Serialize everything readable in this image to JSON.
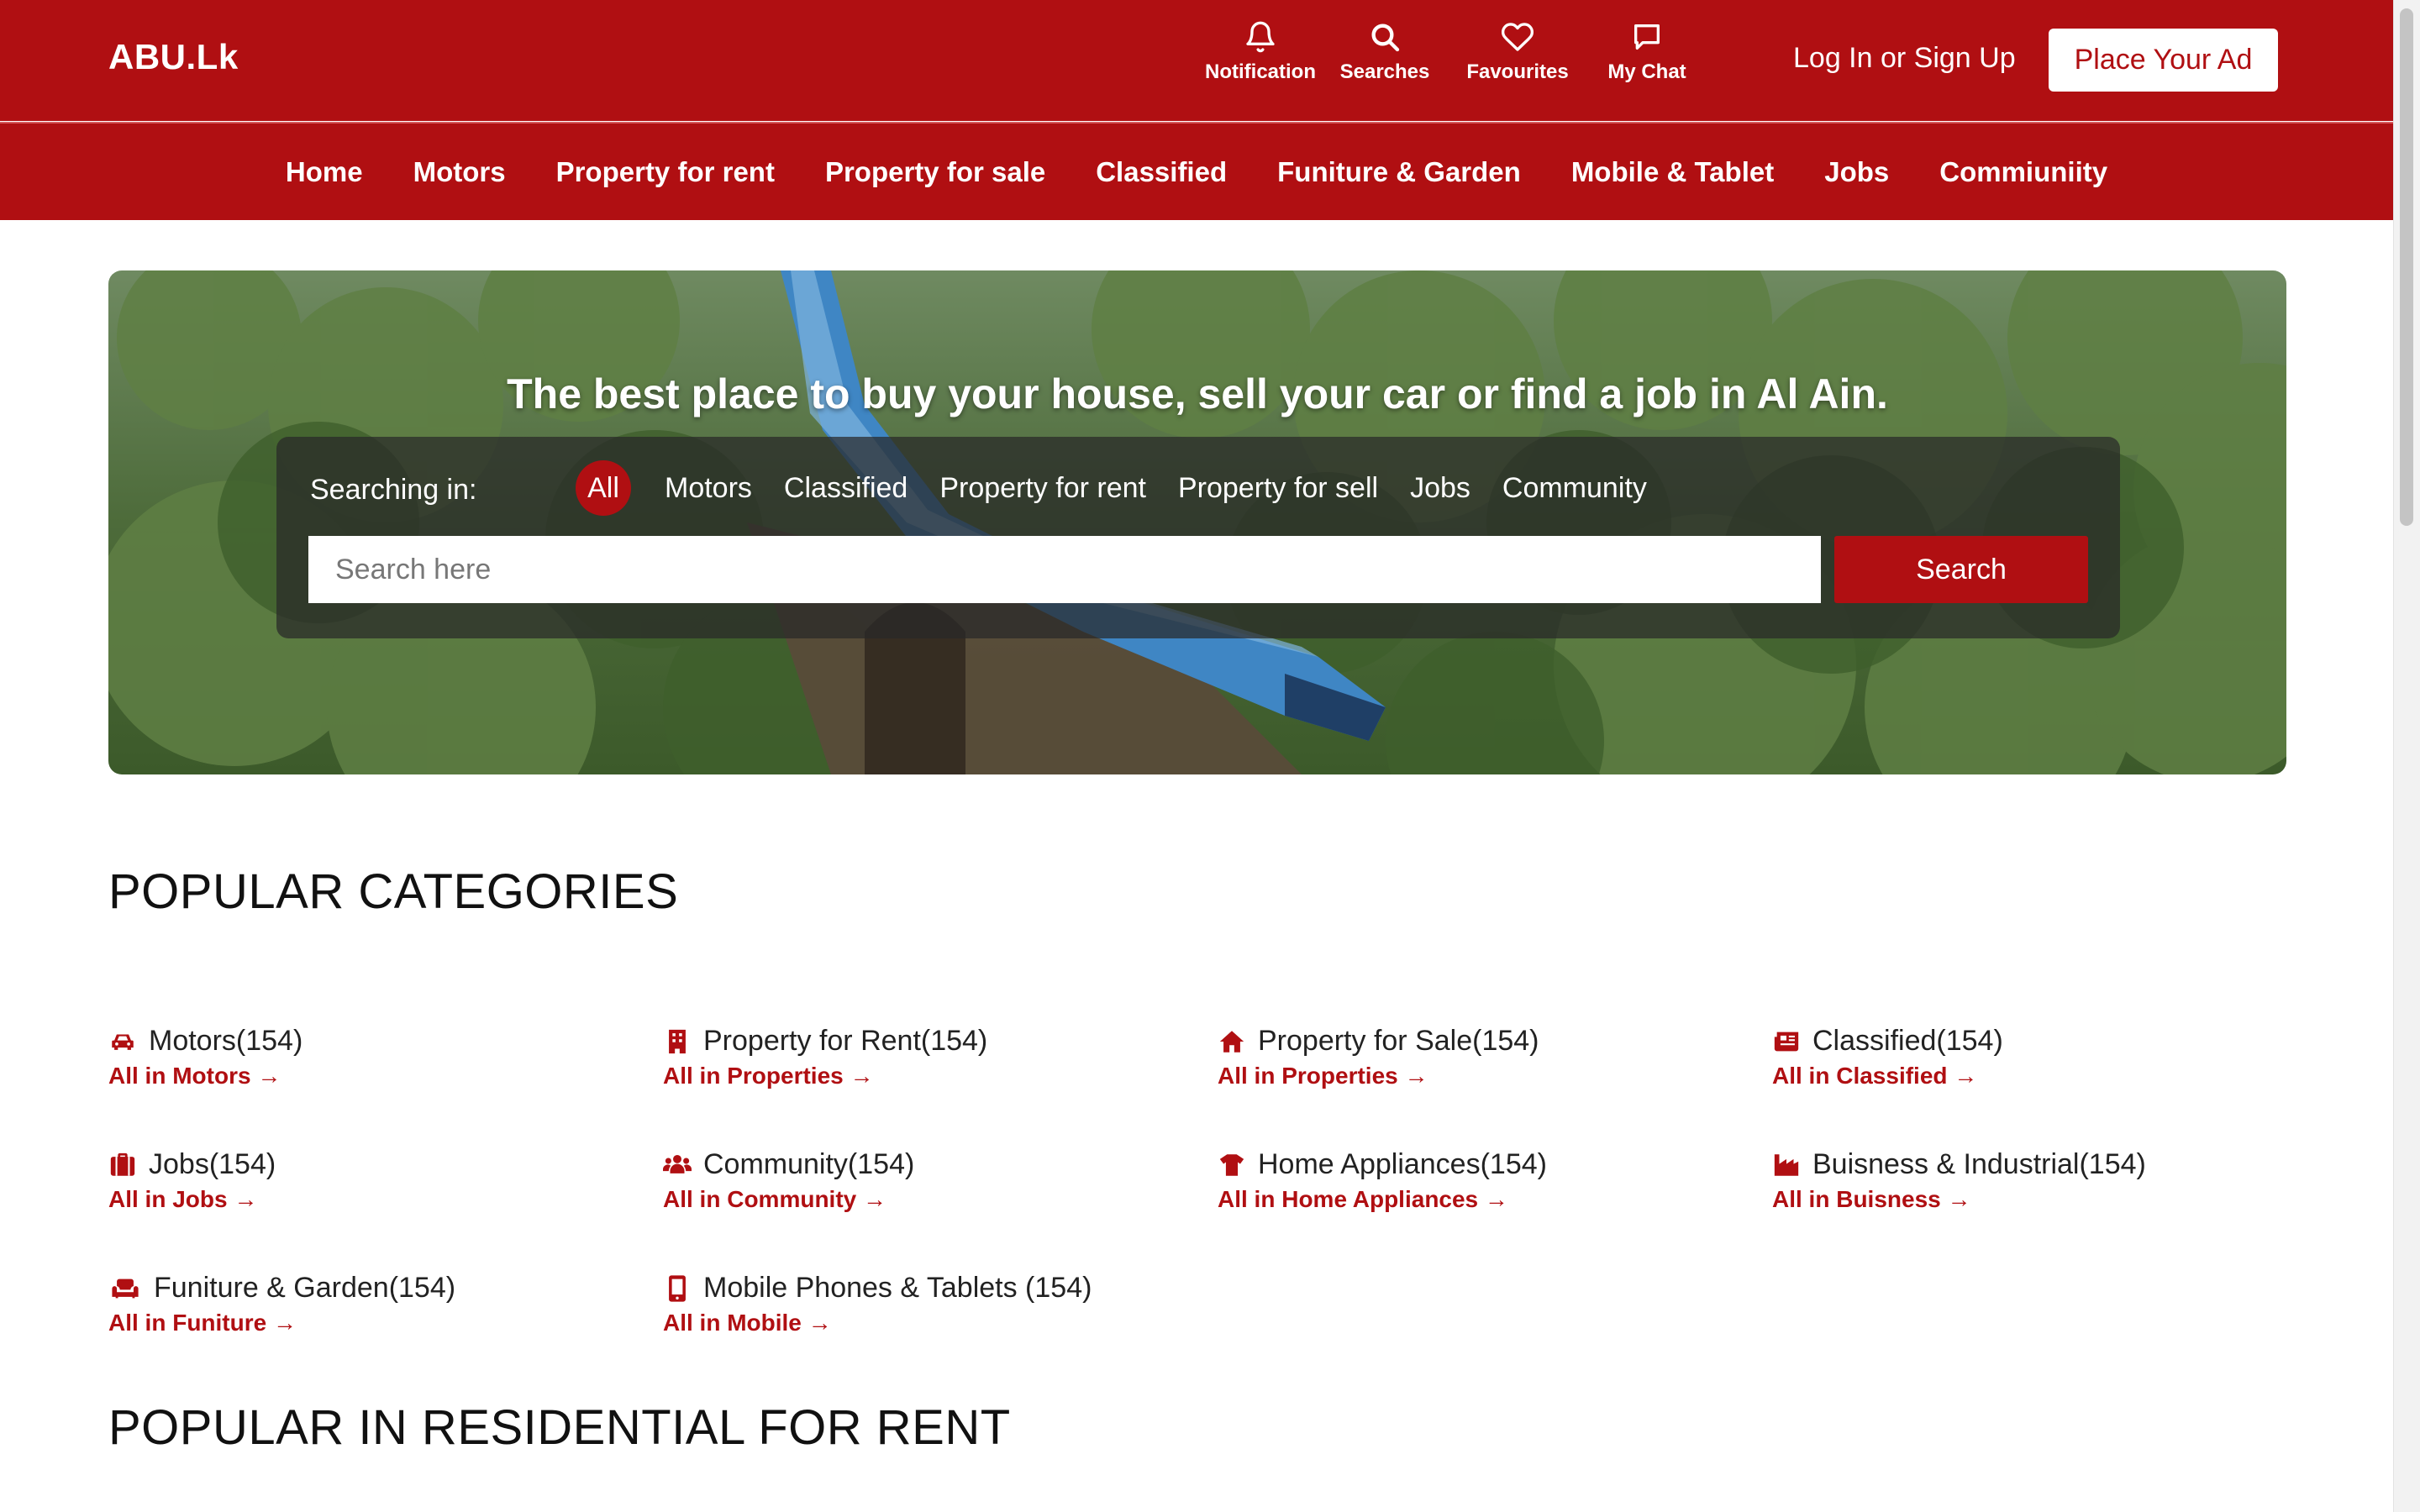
{
  "header": {
    "logo": "ABU.Lk",
    "icons": [
      {
        "icon": "bell-icon",
        "label": "Notification"
      },
      {
        "icon": "search-icon",
        "label": "Searches"
      },
      {
        "icon": "heart-icon",
        "label": "Favourites"
      },
      {
        "icon": "chat-icon",
        "label": "My Chat"
      }
    ],
    "login_label": "Log In or Sign Up",
    "place_ad_label": "Place Your Ad"
  },
  "nav": {
    "items": [
      "Home",
      "Motors",
      "Property for rent",
      "Property for sale",
      "Classified",
      "Funiture & Garden",
      "Mobile & Tablet",
      "Jobs",
      "Commiuniity"
    ]
  },
  "hero": {
    "title": "The best place to buy your house, sell your car or find a job in Al Ain.",
    "searching_label": "Searching in:",
    "filters": [
      "All",
      "Motors",
      "Classified",
      "Property for rent",
      "Property for sell",
      "Jobs",
      "Community"
    ],
    "active_filter": "All",
    "search_placeholder": "Search here",
    "search_button": "Search"
  },
  "popular_categories": {
    "title": "POPULAR CATEGORIES",
    "items": [
      {
        "icon": "car-icon",
        "name": "Motors(154)",
        "link": "All in Motors"
      },
      {
        "icon": "building-icon",
        "name": "Property for Rent(154)",
        "link": "All in Properties"
      },
      {
        "icon": "home-icon",
        "name": "Property for Sale(154)",
        "link": "All in Properties"
      },
      {
        "icon": "newspaper-icon",
        "name": "Classified(154)",
        "link": "All in Classified"
      },
      {
        "icon": "briefcase-icon",
        "name": "Jobs(154)",
        "link": "All in Jobs"
      },
      {
        "icon": "users-icon",
        "name": "Community(154)",
        "link": "All in Community"
      },
      {
        "icon": "shirt-icon",
        "name": "Home Appliances(154)",
        "link": "All in Home Appliances"
      },
      {
        "icon": "industry-icon",
        "name": "Buisness & Industrial(154)",
        "link": "All in Buisness"
      },
      {
        "icon": "couch-icon",
        "name": "Funiture & Garden(154)",
        "link": "All in Funiture"
      },
      {
        "icon": "mobile-icon",
        "name": "Mobile Phones & Tablets (154)",
        "link": "All in Mobile"
      }
    ]
  },
  "popular_residential": {
    "title": "POPULAR IN RESIDENTIAL FOR RENT"
  },
  "colors": {
    "brand": "#b00f12",
    "white": "#ffffff"
  }
}
